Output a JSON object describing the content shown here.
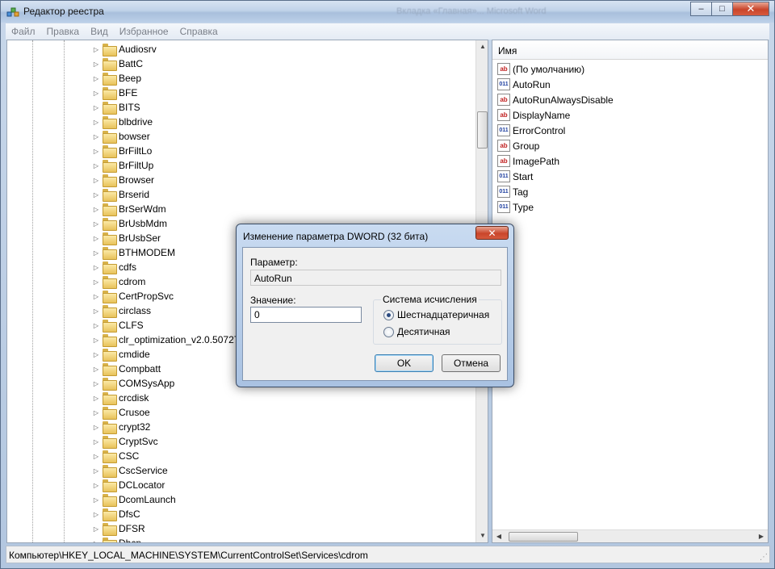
{
  "window": {
    "title": "Редактор реестра",
    "ghost_title": "Вкладка «Главная»...  Microsoft Word",
    "buttons": {
      "minimize": "–",
      "maximize": "□",
      "close": "✕"
    }
  },
  "menu": [
    "Файл",
    "Правка",
    "Вид",
    "Избранное",
    "Справка"
  ],
  "tree": {
    "items": [
      {
        "label": "Audiosrv",
        "expandable": true
      },
      {
        "label": "BattC",
        "expandable": true
      },
      {
        "label": "Beep",
        "expandable": true
      },
      {
        "label": "BFE",
        "expandable": true
      },
      {
        "label": "BITS",
        "expandable": true
      },
      {
        "label": "blbdrive",
        "expandable": true
      },
      {
        "label": "bowser",
        "expandable": true
      },
      {
        "label": "BrFiltLo",
        "expandable": true
      },
      {
        "label": "BrFiltUp",
        "expandable": true
      },
      {
        "label": "Browser",
        "expandable": true
      },
      {
        "label": "Brserid",
        "expandable": true
      },
      {
        "label": "BrSerWdm",
        "expandable": true
      },
      {
        "label": "BrUsbMdm",
        "expandable": true
      },
      {
        "label": "BrUsbSer",
        "expandable": true
      },
      {
        "label": "BTHMODEM",
        "expandable": true
      },
      {
        "label": "cdfs",
        "expandable": true
      },
      {
        "label": "cdrom",
        "expandable": true
      },
      {
        "label": "CertPropSvc",
        "expandable": true
      },
      {
        "label": "circlass",
        "expandable": true
      },
      {
        "label": "CLFS",
        "expandable": true
      },
      {
        "label": "clr_optimization_v2.0.50727_",
        "expandable": true
      },
      {
        "label": "cmdide",
        "expandable": true
      },
      {
        "label": "Compbatt",
        "expandable": true
      },
      {
        "label": "COMSysApp",
        "expandable": true
      },
      {
        "label": "crcdisk",
        "expandable": true
      },
      {
        "label": "Crusoe",
        "expandable": true
      },
      {
        "label": "crypt32",
        "expandable": true
      },
      {
        "label": "CryptSvc",
        "expandable": true
      },
      {
        "label": "CSC",
        "expandable": true
      },
      {
        "label": "CscService",
        "expandable": true
      },
      {
        "label": "DCLocator",
        "expandable": true
      },
      {
        "label": "DcomLaunch",
        "expandable": true
      },
      {
        "label": "DfsC",
        "expandable": true
      },
      {
        "label": "DFSR",
        "expandable": true
      },
      {
        "label": "Dhcp",
        "expandable": true
      }
    ]
  },
  "values": {
    "header": "Имя",
    "items": [
      {
        "name": "(По умолчанию)",
        "type": "string"
      },
      {
        "name": "AutoRun",
        "type": "binary"
      },
      {
        "name": "AutoRunAlwaysDisable",
        "type": "string"
      },
      {
        "name": "DisplayName",
        "type": "string"
      },
      {
        "name": "ErrorControl",
        "type": "binary"
      },
      {
        "name": "Group",
        "type": "string"
      },
      {
        "name": "ImagePath",
        "type": "string"
      },
      {
        "name": "Start",
        "type": "binary"
      },
      {
        "name": "Tag",
        "type": "binary"
      },
      {
        "name": "Type",
        "type": "binary"
      }
    ],
    "icon_labels": {
      "string": "ab",
      "binary": "011"
    }
  },
  "status": {
    "path": "Компьютер\\HKEY_LOCAL_MACHINE\\SYSTEM\\CurrentControlSet\\Services\\cdrom"
  },
  "dialog": {
    "title": "Изменение параметра DWORD (32 бита)",
    "param_label": "Параметр:",
    "param_value": "AutoRun",
    "value_label": "Значение:",
    "value": "0",
    "base_group_label": "Система исчисления",
    "base_options": [
      "Шестнадцатеричная",
      "Десятичная"
    ],
    "base_selected": "Шестнадцатеричная",
    "ok_label": "OK",
    "cancel_label": "Отмена",
    "close_glyph": "✕"
  },
  "colors": {
    "title_gradient_top": "#d7e3f2",
    "close_red": "#c9452a",
    "folder_yellow": "#e8c25a"
  }
}
